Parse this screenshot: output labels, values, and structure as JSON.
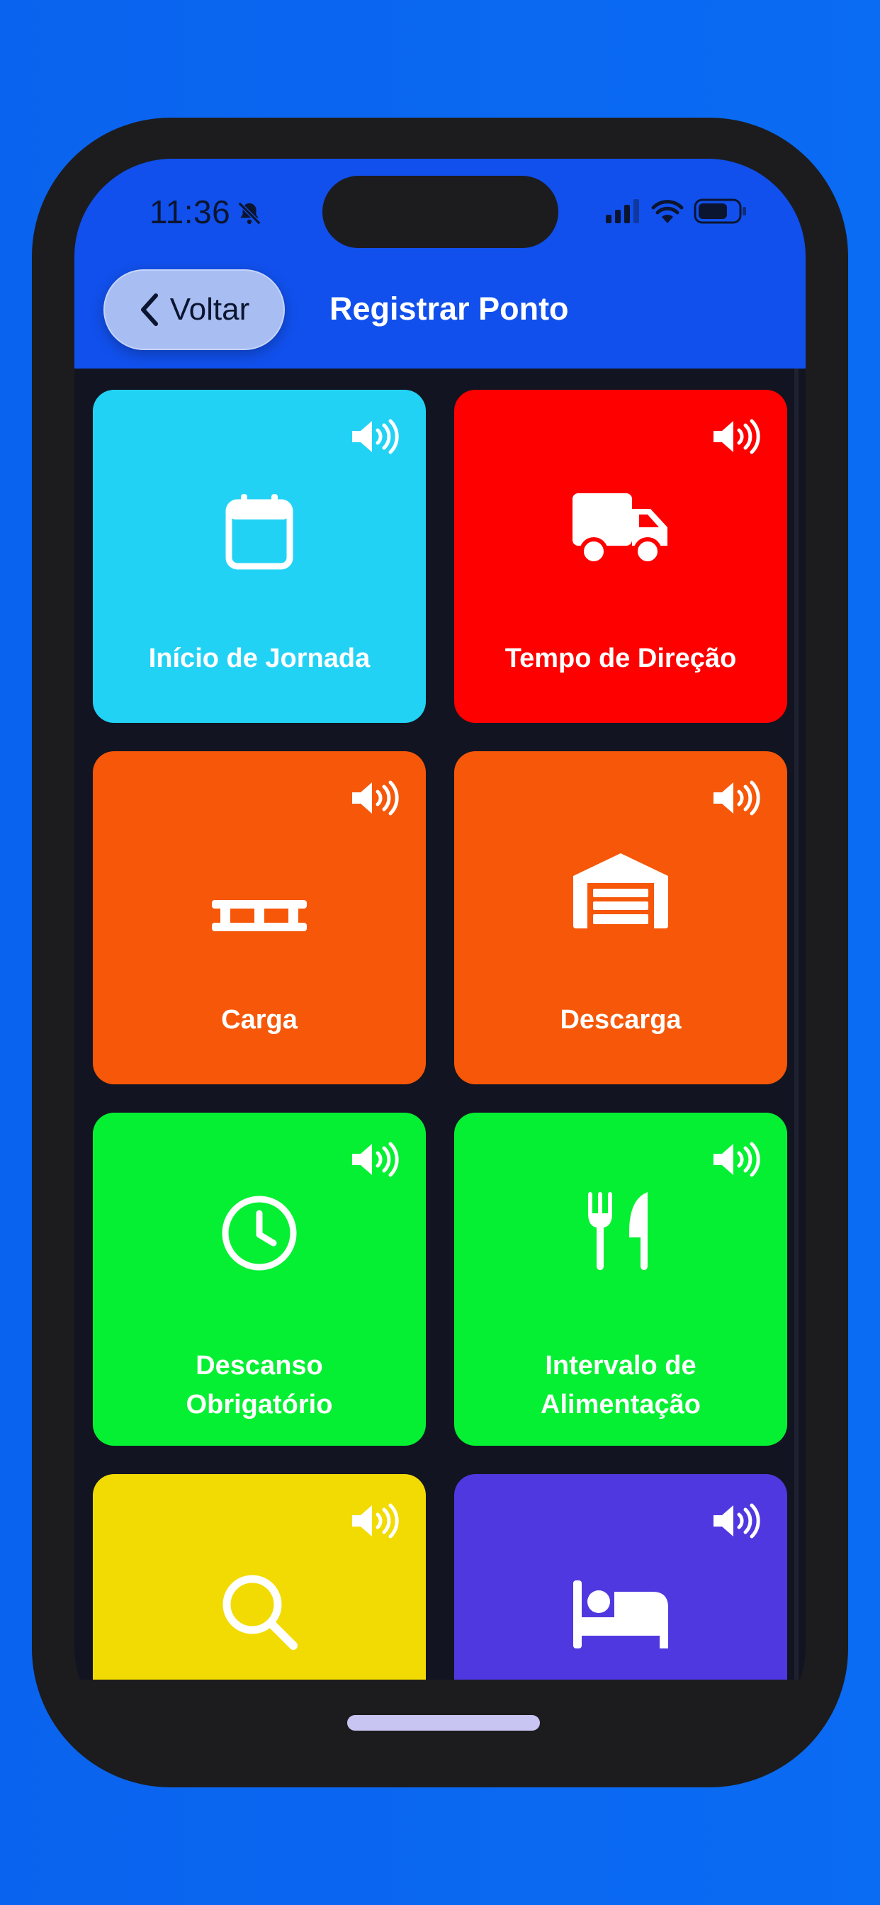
{
  "status_bar": {
    "time": "11:36",
    "icons": [
      "bell-slash-icon",
      "cellular-signal-icon",
      "wifi-icon",
      "battery-icon"
    ]
  },
  "header": {
    "back_label": "Voltar",
    "title": "Registrar Ponto"
  },
  "tiles": [
    {
      "label": "Início de Jornada",
      "icon": "calendar-icon",
      "color": "#22d2f5"
    },
    {
      "label": "Tempo de Direção",
      "icon": "truck-icon",
      "color": "#fe0000"
    },
    {
      "label": "Carga",
      "icon": "pallet-icon",
      "color": "#f65709"
    },
    {
      "label": "Descarga",
      "icon": "warehouse-icon",
      "color": "#f65709"
    },
    {
      "label_lines": [
        "Descanso",
        "Obrigatório"
      ],
      "icon": "clock-icon",
      "color": "#05f032"
    },
    {
      "label_lines": [
        "Intervalo de",
        "Alimentação"
      ],
      "icon": "utensils-icon",
      "color": "#05f032"
    },
    {
      "label": "",
      "icon": "search-icon",
      "color": "#f2db02"
    },
    {
      "label": "",
      "icon": "bed-icon",
      "color": "#5038e0"
    }
  ],
  "colors": {
    "background": "#0a66f0",
    "header": "#1150ec",
    "screen": "#121521"
  }
}
